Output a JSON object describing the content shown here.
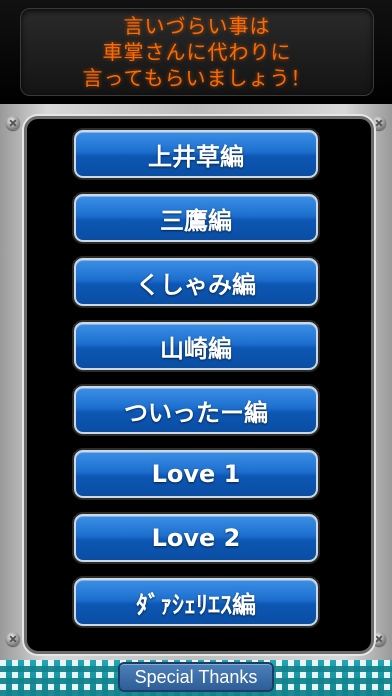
{
  "banner": {
    "lines": [
      "言いづらい事は",
      "車掌さんに代わりに",
      "言ってもらいましょう！"
    ],
    "color": "#ff6a00"
  },
  "menu": {
    "items": [
      {
        "label": "上井草編"
      },
      {
        "label": "三鷹編"
      },
      {
        "label": "くしゃみ編"
      },
      {
        "label": "山崎編"
      },
      {
        "label": "ついったー編"
      },
      {
        "label": "Love 1"
      },
      {
        "label": "Love 2"
      },
      {
        "label": "ﾀﾞｧｼｪﾘｴｽ編"
      }
    ],
    "button_color": "#1d6fcf"
  },
  "footer": {
    "special_thanks_label": "Special Thanks"
  }
}
